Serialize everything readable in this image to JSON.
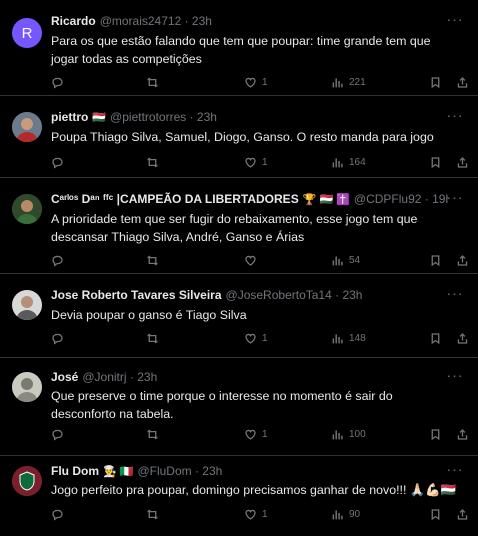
{
  "tweets": [
    {
      "name": "Ricardo",
      "handle": "@morais24712 · 23h",
      "avatar_letter": "R",
      "text": "Para os que estão falando que tem que poupar: time grande tem que jogar todas as competições",
      "likes": "1",
      "views": "221"
    },
    {
      "name": "piettro",
      "name_badge": "🇭🇺",
      "handle": "@piettrotorres · 23h",
      "text": "Poupa Thiago Silva, Samuel, Diogo, Ganso. O resto manda para jogo",
      "likes": "1",
      "views": "164"
    },
    {
      "name": "Cᵃʳˡᵒˢ Dᵃⁿ ᶠᶠᶜ |CAMPEÃO DA LIBERTADORES",
      "name_badge": "🏆 🇭🇺 ✝️",
      "handle": "@CDPFlu92 · 19h",
      "text": "A prioridade tem que ser fugir do rebaixamento, esse jogo tem que descansar Thiago Silva, André, Ganso e Árias",
      "likes": "",
      "views": "54"
    },
    {
      "name": "Jose Roberto Tavares Silveira",
      "handle": "@JoseRobertoTa14 · 23h",
      "text": "Devia poupar o ganso é Tiago Silva",
      "likes": "1",
      "views": "148"
    },
    {
      "name": "José",
      "handle": "@Jonitrj · 23h",
      "text": "Que preserve o time porque o interesse no momento é sair do desconforto na tabela.",
      "likes": "1",
      "views": "100"
    },
    {
      "name": "Flu Dom",
      "name_badge": "👨‍🍳 🇮🇹",
      "handle": "@FluDom · 23h",
      "text": "Jogo perfeito pra poupar,  domingo precisamos ganhar de novo!!! 🙏🏻💪🏻🇭🇺",
      "likes": "1",
      "views": "90"
    }
  ],
  "icons": {
    "reply": "reply-icon",
    "retweet": "retweet-icon",
    "like": "heart-icon",
    "views": "views-icon",
    "bookmark": "bookmark-icon",
    "share": "share-icon",
    "more": "more-icon"
  },
  "colors": {
    "background": "#000000",
    "text": "#e7e9ea",
    "muted": "#71767b",
    "divider": "#2f3336",
    "avatar_r": "#7856ff"
  }
}
